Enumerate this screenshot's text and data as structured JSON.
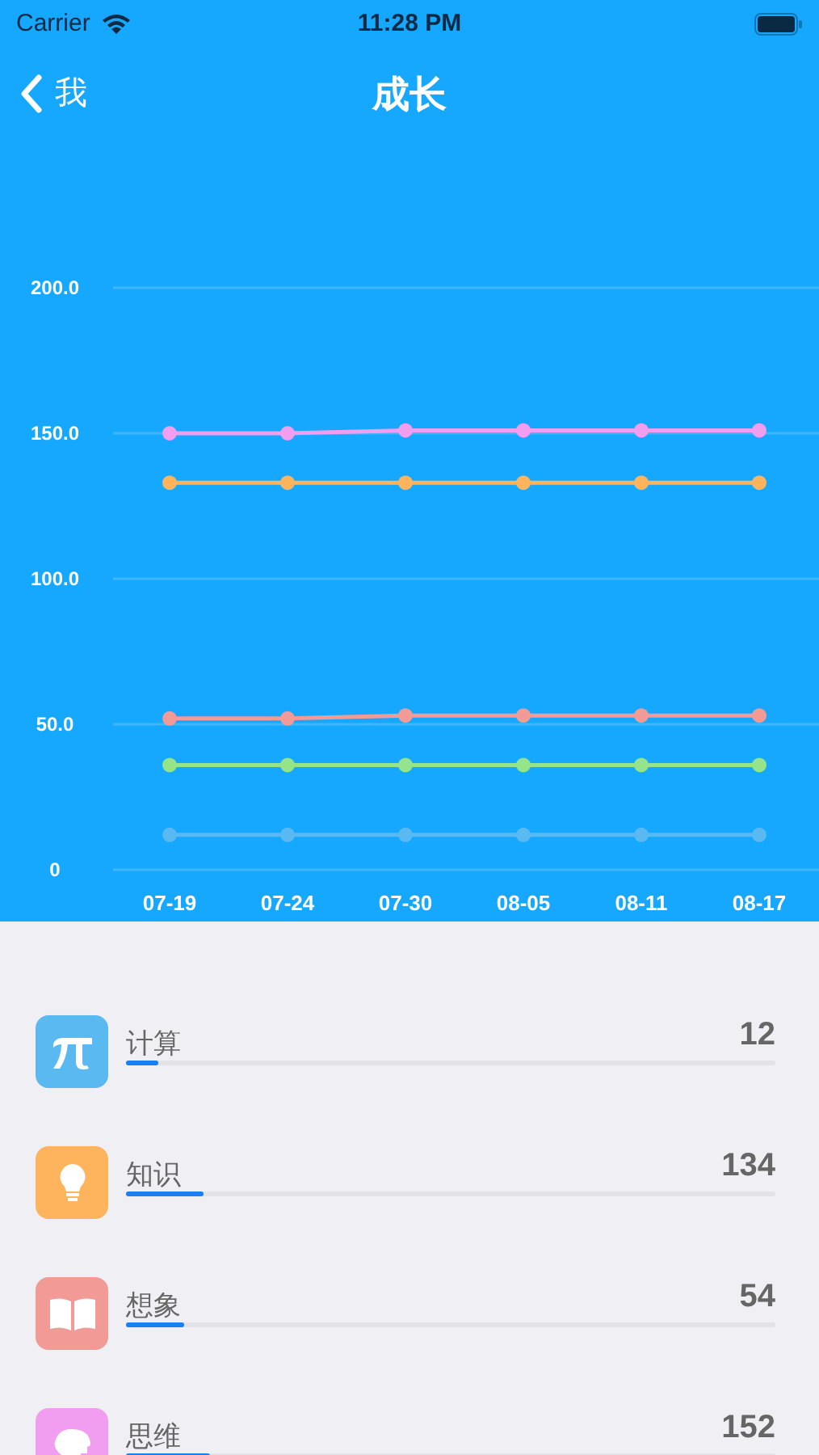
{
  "status_bar": {
    "carrier": "Carrier",
    "time": "11:28 PM"
  },
  "nav": {
    "back_label": "我",
    "title": "成长"
  },
  "chart": {
    "chart_data": {
      "type": "line",
      "categories": [
        "07-19",
        "07-24",
        "07-30",
        "08-05",
        "08-11",
        "08-17"
      ],
      "ylim": [
        0,
        200
      ],
      "yticks": [
        {
          "value": 0,
          "label": "0"
        },
        {
          "value": 50,
          "label": "50.0"
        },
        {
          "value": 100,
          "label": "100.0"
        },
        {
          "value": 150,
          "label": "150.0"
        },
        {
          "value": 200,
          "label": "200.0"
        }
      ],
      "grid": true,
      "series": [
        {
          "color": "#f19ef0",
          "marker": "circle",
          "values": [
            150,
            150,
            151,
            151,
            151,
            151
          ]
        },
        {
          "color": "#fdb45c",
          "marker": "circle",
          "values": [
            133,
            133,
            133,
            133,
            133,
            133
          ]
        },
        {
          "color": "#f19a96",
          "marker": "circle",
          "values": [
            52,
            52,
            53,
            53,
            53,
            53
          ]
        },
        {
          "color": "#96e48a",
          "marker": "circle",
          "values": [
            36,
            36,
            36,
            36,
            36,
            36
          ]
        },
        {
          "color": "#5ab9f0",
          "marker": "circle",
          "values": [
            12,
            12,
            12,
            12,
            12,
            12
          ]
        }
      ]
    }
  },
  "skills": [
    {
      "kind": "pi",
      "label": "计算",
      "value": "12",
      "level": 0.05,
      "color": "#5ab9f0"
    },
    {
      "kind": "bulb",
      "label": "知识",
      "value": "134",
      "level": 0.12,
      "color": "#fdb45c"
    },
    {
      "kind": "book",
      "label": "想象",
      "value": "54",
      "level": 0.09,
      "color": "#f19a96"
    },
    {
      "kind": "head",
      "label": "思维",
      "value": "152",
      "level": 0.13,
      "color": "#f19ef0"
    }
  ]
}
